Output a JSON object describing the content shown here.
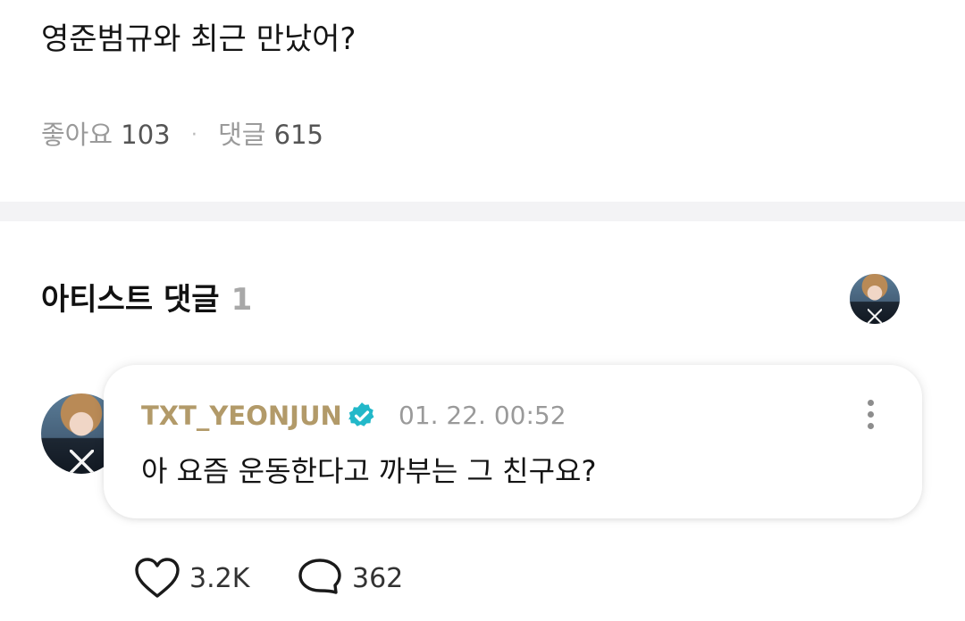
{
  "post": {
    "text": "영준범규와 최근 만났어?",
    "likes_label": "좋아요",
    "likes_count": "103",
    "separator": "·",
    "comments_label": "댓글",
    "comments_count": "615"
  },
  "artist_comments": {
    "title": "아티스트 댓글",
    "count": "1",
    "avatar_icon": "artist-avatar"
  },
  "comment": {
    "author": "TXT_YEONJUN",
    "verified_icon": "verified-badge-icon",
    "time": "01. 22. 00:52",
    "body": "아 요즘 운동한다고 까부는 그 친구요?",
    "likes": "3.2K",
    "replies": "362",
    "more_icon": "more-vertical-icon"
  },
  "colors": {
    "author": "#b29a69",
    "verified": "#22b8c9",
    "muted": "#9a9a9a",
    "divider": "#f3f3f5"
  }
}
